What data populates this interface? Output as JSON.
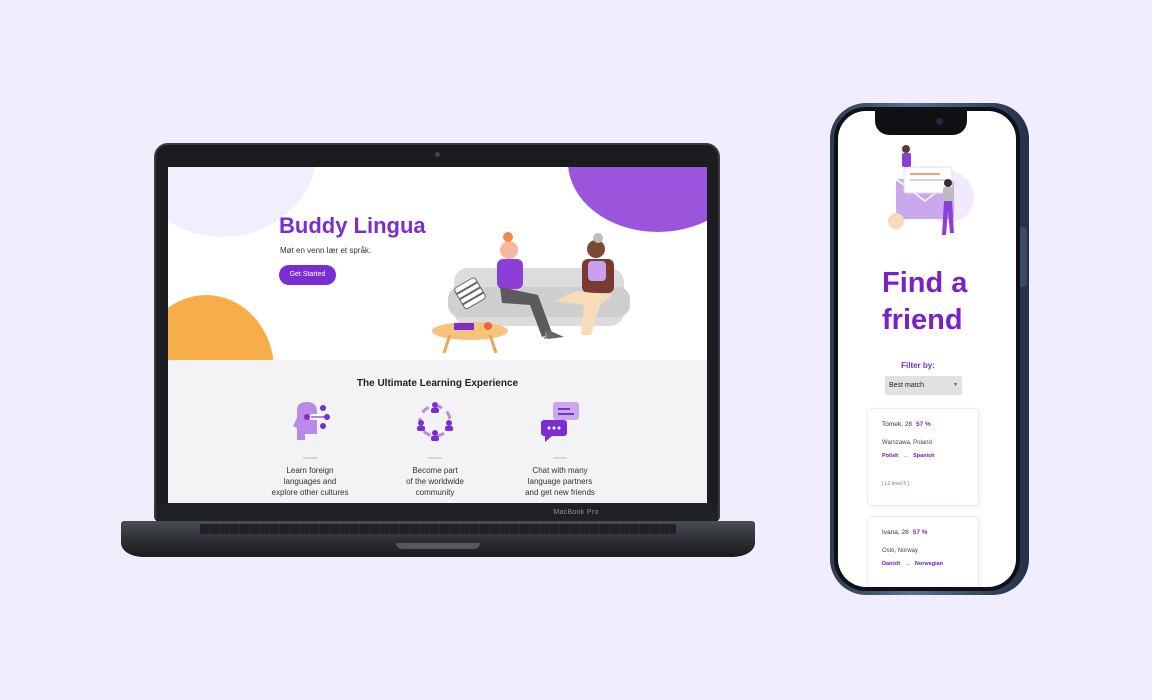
{
  "laptop": {
    "brand_label": "MacBook Pro",
    "site": {
      "title": "Buddy Lingua",
      "subtitle": "Møt en venn lær et språk.",
      "cta_label": "Get Started",
      "features_heading": "The Ultimate Learning Experience",
      "features": [
        {
          "icon": "head-network-icon",
          "lines": [
            "Learn foreign",
            "languages and",
            "explore other cultures"
          ]
        },
        {
          "icon": "community-icon",
          "lines": [
            "Become part",
            "of the worldwide",
            "community"
          ]
        },
        {
          "icon": "chat-bubbles-icon",
          "lines": [
            "Chat with many",
            "language partners",
            "and get new friends"
          ]
        }
      ]
    }
  },
  "phone": {
    "title_line1": "Find a",
    "title_line2": "friend",
    "filter_label": "Filter by:",
    "filter_value": "Best match",
    "cards": [
      {
        "name": "Tomek, 28",
        "match": "57 %",
        "location": "Warszawa, Poland",
        "from": "Polish",
        "to": "Spanish",
        "arrow": "→",
        "level": "[ L2 level 5 ]"
      },
      {
        "name": "Ivana, 28",
        "match": "57 %",
        "location": "Oslo, Norway",
        "from": "Danish",
        "to": "Norwegian",
        "arrow": "→"
      }
    ]
  },
  "colors": {
    "background": "#f0eefd",
    "brand_purple": "#7a2ed1",
    "accent_orange": "#f8ad4b",
    "blob_purple": "#9a55dc"
  }
}
